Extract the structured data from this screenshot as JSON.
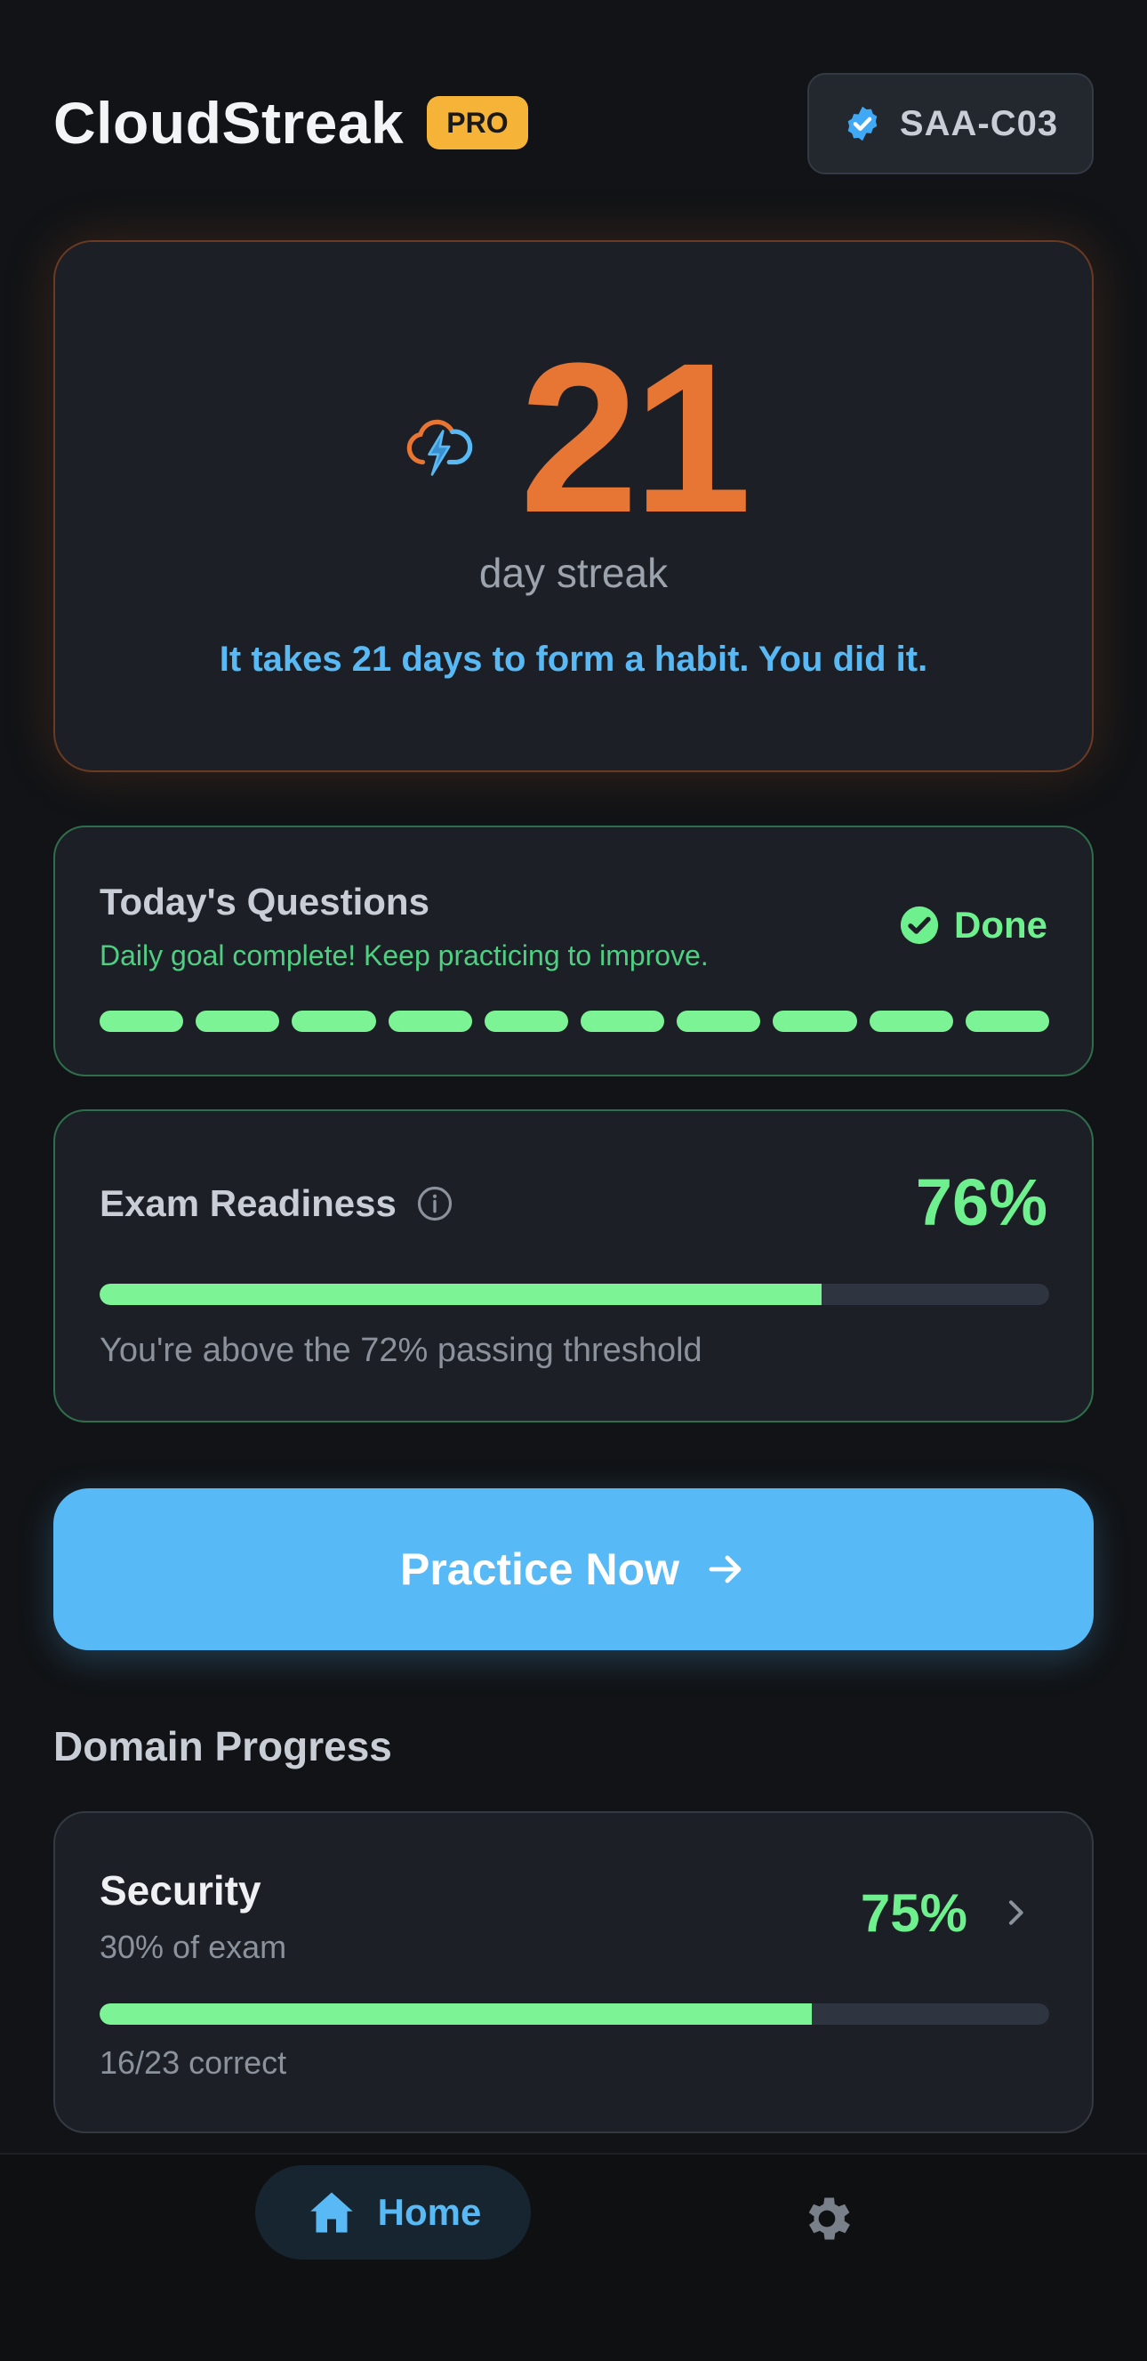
{
  "header": {
    "app_title": "CloudStreak",
    "pro_badge": "PRO",
    "cert_code": "SAA-C03"
  },
  "streak": {
    "count": "21",
    "label": "day streak",
    "message": "It takes 21 days to form a habit. You did it."
  },
  "today": {
    "title": "Today's Questions",
    "subtitle": "Daily goal complete! Keep practicing to improve.",
    "status": "Done",
    "completed": 10,
    "total": 10
  },
  "readiness": {
    "title": "Exam Readiness",
    "percent_label": "76%",
    "percent": 76,
    "note": "You're above the 72% passing threshold"
  },
  "practice": {
    "label": "Practice Now"
  },
  "domains": {
    "section_title": "Domain Progress",
    "items": [
      {
        "name": "Security",
        "weight": "30% of exam",
        "percent_label": "75%",
        "percent": 75,
        "correct": "16/23 correct"
      }
    ]
  },
  "nav": {
    "home_label": "Home"
  },
  "colors": {
    "accent_blue": "#58b9f7",
    "streak_orange": "#e77634",
    "success_green": "#7cf394",
    "pro_gold": "#f5b338"
  },
  "icons": {
    "cert": "verified-badge-icon",
    "streak": "cloud-lightning-icon",
    "done": "check-circle-icon",
    "info": "info-icon",
    "practice": "arrow-right-icon",
    "domain": "chevron-right-icon",
    "home": "home-icon",
    "settings": "gear-icon"
  }
}
